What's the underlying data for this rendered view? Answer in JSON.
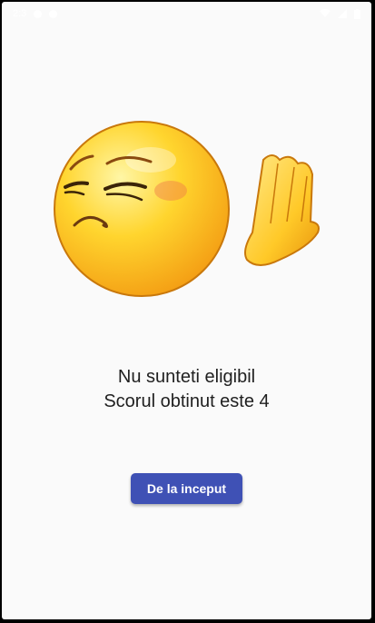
{
  "status_bar": {
    "time": "2:3",
    "left_icons": [
      "settings-dot-icon",
      "notification-dot-icon"
    ],
    "right_icons": [
      "wifi-icon",
      "signal-icon",
      "battery-icon"
    ]
  },
  "illustration": {
    "icon": "unimpressed-emoji-hand-icon"
  },
  "result": {
    "line1": "Nu sunteti eligibil",
    "line2": "Scorul obtinut este 4"
  },
  "actions": {
    "restart_label": "De la inceput"
  },
  "colors": {
    "button": "#3f51b5",
    "background": "#fafafa",
    "text": "#1f1f1f"
  }
}
